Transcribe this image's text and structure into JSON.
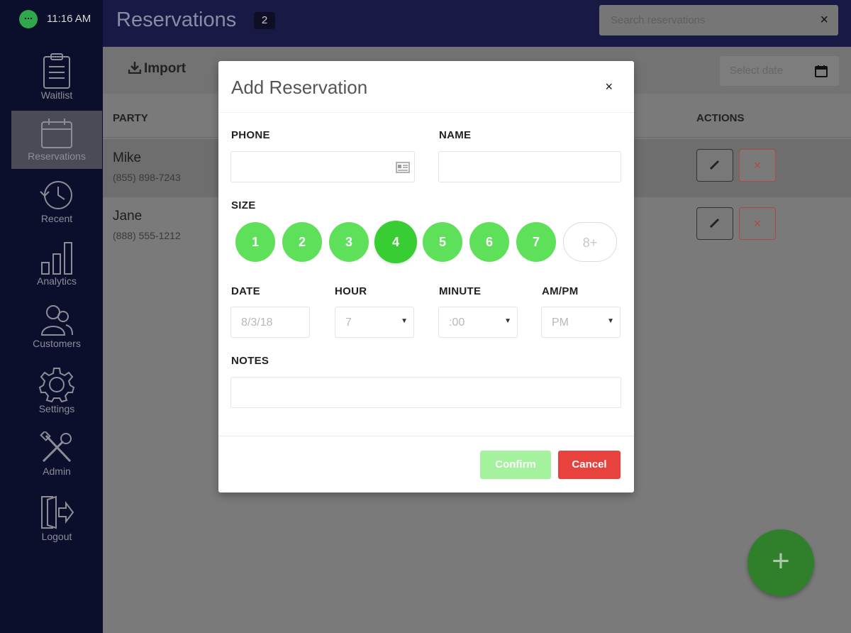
{
  "status": {
    "time": "11:16 AM"
  },
  "sidebar": {
    "items": [
      {
        "label": "Waitlist",
        "icon": "clipboard-icon"
      },
      {
        "label": "Reservations",
        "icon": "calendar-icon",
        "active": true
      },
      {
        "label": "Recent",
        "icon": "history-icon"
      },
      {
        "label": "Analytics",
        "icon": "bar-chart-icon"
      },
      {
        "label": "Customers",
        "icon": "customers-icon"
      },
      {
        "label": "Settings",
        "icon": "gear-icon"
      },
      {
        "label": "Admin",
        "icon": "tools-icon"
      },
      {
        "label": "Logout",
        "icon": "logout-icon"
      }
    ]
  },
  "header": {
    "title": "Reservations",
    "count": "2",
    "search_placeholder": "Search reservations",
    "search_clear": "×"
  },
  "toolbar": {
    "import_label": "Import",
    "date_placeholder": "Select date"
  },
  "table": {
    "columns": {
      "party": "PARTY",
      "actions": "ACTIONS"
    },
    "rows": [
      {
        "name": "Mike",
        "phone": "(855) 898-7243",
        "delete": "×"
      },
      {
        "name": "Jane",
        "phone": "(888) 555-1212",
        "delete": "×"
      }
    ]
  },
  "fab": {
    "label": "+"
  },
  "modal": {
    "title": "Add Reservation",
    "close": "×",
    "phone_label": "PHONE",
    "name_label": "NAME",
    "size_label": "SIZE",
    "sizes": [
      "1",
      "2",
      "3",
      "4",
      "5",
      "6",
      "7",
      "8+"
    ],
    "selected_size": "4",
    "date_label": "DATE",
    "date_value": "8/3/18",
    "hour_label": "HOUR",
    "hour_value": "7",
    "minute_label": "MINUTE",
    "minute_value": ":00",
    "ampm_label": "AM/PM",
    "ampm_value": "PM",
    "notes_label": "NOTES",
    "confirm_label": "Confirm",
    "cancel_label": "Cancel"
  },
  "colors": {
    "sidebar_bg": "#0c0f2c",
    "header_bg": "#181a45",
    "size_green": "#5fe05a",
    "size_selected": "#37cd33",
    "confirm": "#a4f19e",
    "cancel": "#e8423e",
    "fab": "#2f7f2b"
  }
}
